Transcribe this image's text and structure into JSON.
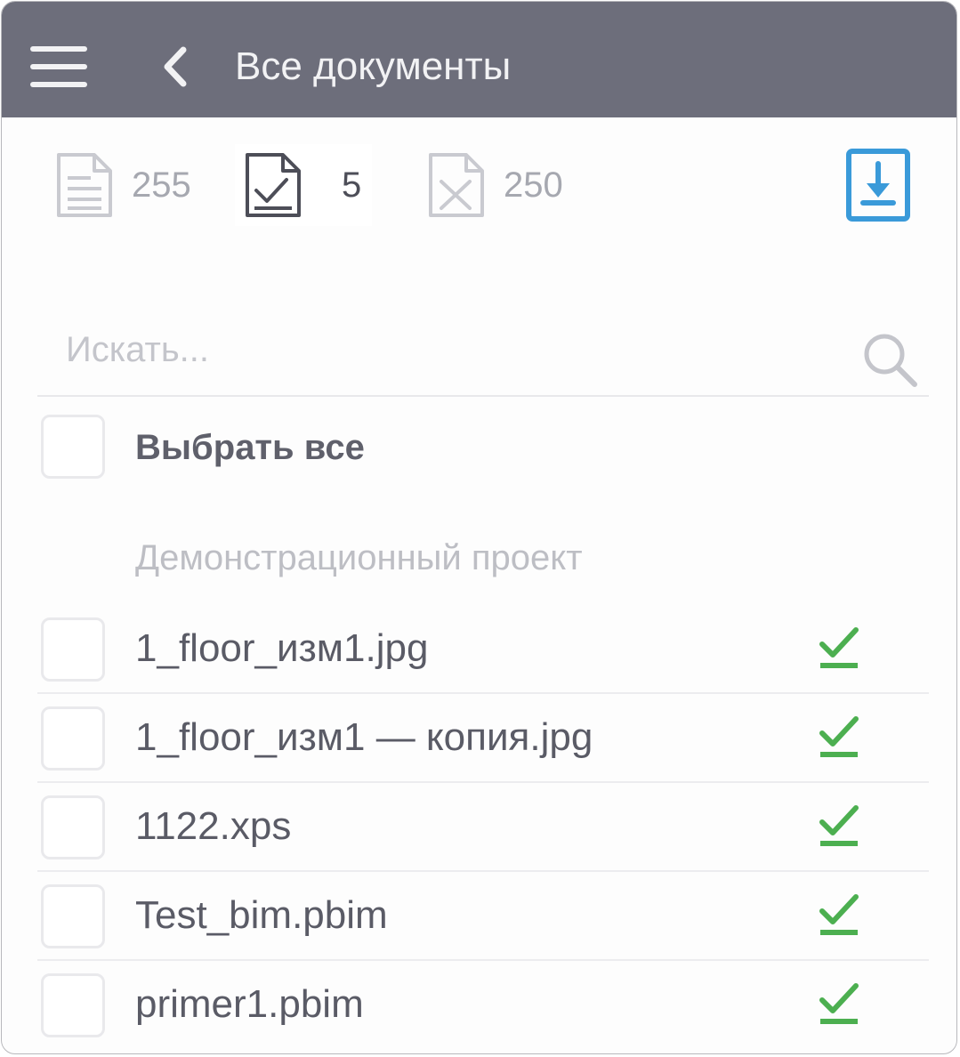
{
  "appbar": {
    "title": "Все документы",
    "menu_icon": "hamburger-menu-icon",
    "back_icon": "chevron-left-icon",
    "background": "#6d6e7b"
  },
  "filters": {
    "all": {
      "icon": "document-icon",
      "count": "255"
    },
    "approved": {
      "icon": "document-check-icon",
      "count": "5",
      "selected": true
    },
    "rejected": {
      "icon": "document-cross-icon",
      "count": "250"
    },
    "download_icon": "download-icon",
    "accent_color": "#3a9ad9"
  },
  "search": {
    "placeholder": "Искать...",
    "value": "",
    "icon": "search-icon"
  },
  "select_all": {
    "label": "Выбрать все",
    "checked": false
  },
  "group": {
    "title": "Демонстрационный проект"
  },
  "documents": [
    {
      "name": "1_floor_изм1.jpg",
      "checked": false,
      "status": "approved"
    },
    {
      "name": "1_floor_изм1 — копия.jpg",
      "checked": false,
      "status": "approved"
    },
    {
      "name": "1122.xps",
      "checked": false,
      "status": "approved"
    },
    {
      "name": "Test_bim.pbim",
      "checked": false,
      "status": "approved"
    },
    {
      "name": "primer1.pbim",
      "checked": false,
      "status": "approved"
    }
  ],
  "status_color": "#4caf50"
}
